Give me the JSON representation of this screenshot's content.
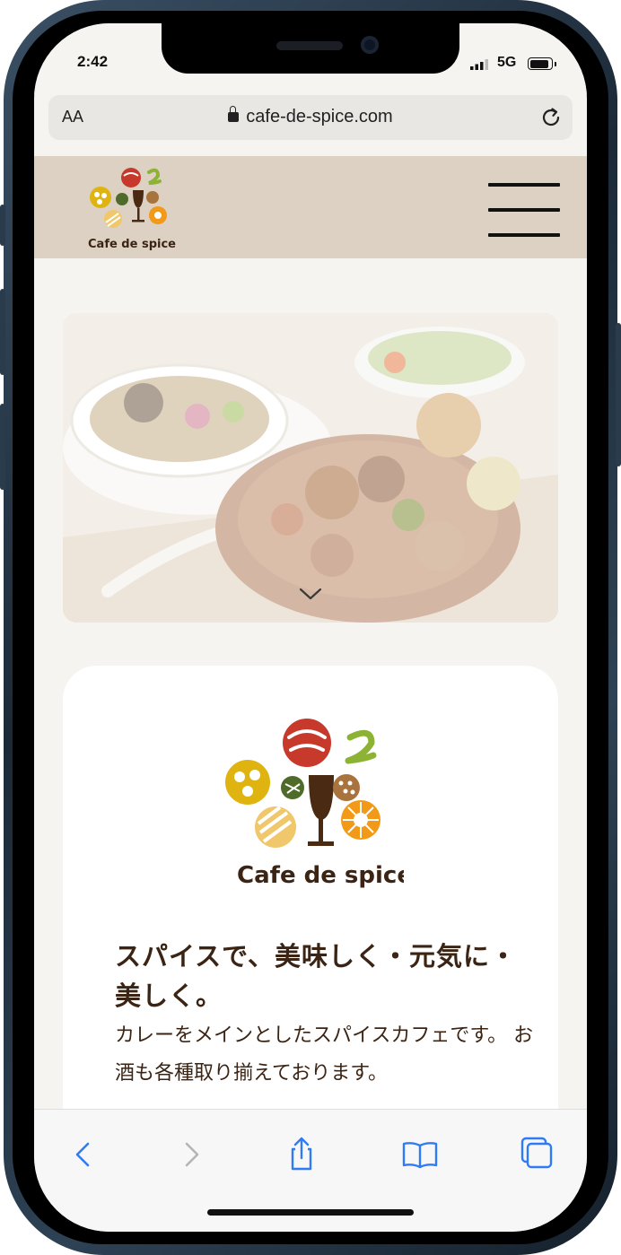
{
  "status_bar": {
    "time": "2:42",
    "network": "5G"
  },
  "browser": {
    "text_size_label": "AA",
    "url": "cafe-de-spice.com"
  },
  "site": {
    "brand": "Cafe de spice"
  },
  "intro": {
    "heading": "スパイスで、美味しく・元気に・美しく。",
    "description": "カレーをメインとしたスパイスカフェです。 お酒も各種取り揃えております。"
  },
  "colors": {
    "header_bg": "#ddd1c3",
    "page_bg": "#f6f4f0",
    "text_brown": "#3b2413",
    "ios_blue": "#2f7bf5"
  },
  "icons": {
    "back": "chevron-left-icon",
    "forward": "chevron-right-icon",
    "share": "share-icon",
    "bookmarks": "book-icon",
    "tabs": "tabs-icon",
    "menu": "hamburger-icon",
    "scroll": "chevron-down-icon"
  }
}
